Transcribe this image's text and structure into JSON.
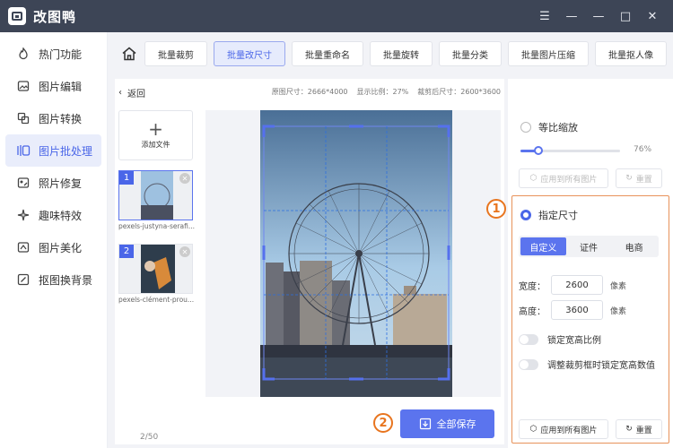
{
  "app": {
    "title": "改图鸭",
    "window_buttons": [
      "☰",
      "—",
      "—",
      "□",
      "✕"
    ]
  },
  "sidebar": {
    "items": [
      {
        "label": "热门功能",
        "icon": "flame-icon"
      },
      {
        "label": "图片编辑",
        "icon": "image-edit-icon"
      },
      {
        "label": "图片转换",
        "icon": "convert-icon"
      },
      {
        "label": "图片批处理",
        "icon": "batch-icon",
        "active": true
      },
      {
        "label": "照片修复",
        "icon": "repair-icon"
      },
      {
        "label": "趣味特效",
        "icon": "sparkle-icon"
      },
      {
        "label": "图片美化",
        "icon": "beautify-icon"
      },
      {
        "label": "抠图换背景",
        "icon": "cutout-icon"
      }
    ]
  },
  "toolbar": {
    "tabs": [
      "批量裁剪",
      "批量改尺寸",
      "批量重命名",
      "批量旋转",
      "批量分类",
      "批量图片压缩",
      "批量抠人像"
    ],
    "active_tab": "批量改尺寸"
  },
  "panel": {
    "back_label": "返回",
    "original_size": "原图尺寸：2666*4000",
    "display_ratio": "显示比例：27%",
    "cropped_size": "裁剪后尺寸：2600*3600",
    "add_file_label": "添加文件",
    "files": [
      {
        "num": "1",
        "name": "pexels-justyna-serafi..."
      },
      {
        "num": "2",
        "name": "pexels-clément-prou..."
      }
    ],
    "page_count": "2/50",
    "save_all_label": "全部保存"
  },
  "annotations": {
    "one": "1",
    "two": "2"
  },
  "right_panel": {
    "proportional_label": "等比缩放",
    "scale_percent": "76%",
    "scale_value": 0.18,
    "apply_all_label": "应用到所有图片",
    "reset_label": "重置",
    "custom_size_label": "指定尺寸",
    "segments": [
      "自定义",
      "证件",
      "电商"
    ],
    "width_label": "宽度：",
    "width_value": "2600",
    "height_label": "高度：",
    "height_value": "3600",
    "unit": "像素",
    "lock_ratio_label": "锁定宽高比例",
    "lock_crop_label": "调整裁剪框时锁定宽高数值"
  },
  "colors": {
    "accent": "#5b74ee",
    "titlebar": "#3d4556",
    "annotation": "#e8751f"
  }
}
